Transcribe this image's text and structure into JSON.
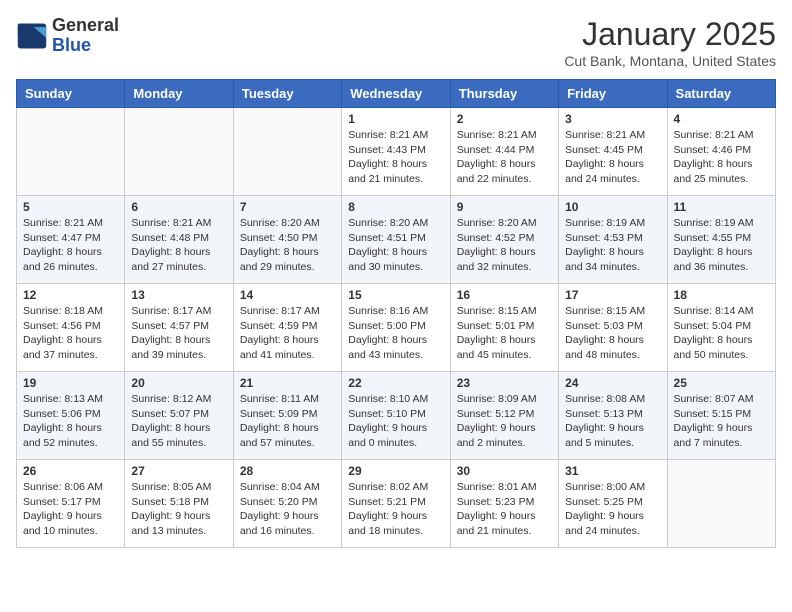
{
  "header": {
    "logo_general": "General",
    "logo_blue": "Blue",
    "month_title": "January 2025",
    "location": "Cut Bank, Montana, United States"
  },
  "days_of_week": [
    "Sunday",
    "Monday",
    "Tuesday",
    "Wednesday",
    "Thursday",
    "Friday",
    "Saturday"
  ],
  "weeks": [
    [
      {
        "day": "",
        "info": ""
      },
      {
        "day": "",
        "info": ""
      },
      {
        "day": "",
        "info": ""
      },
      {
        "day": "1",
        "info": "Sunrise: 8:21 AM\nSunset: 4:43 PM\nDaylight: 8 hours\nand 21 minutes."
      },
      {
        "day": "2",
        "info": "Sunrise: 8:21 AM\nSunset: 4:44 PM\nDaylight: 8 hours\nand 22 minutes."
      },
      {
        "day": "3",
        "info": "Sunrise: 8:21 AM\nSunset: 4:45 PM\nDaylight: 8 hours\nand 24 minutes."
      },
      {
        "day": "4",
        "info": "Sunrise: 8:21 AM\nSunset: 4:46 PM\nDaylight: 8 hours\nand 25 minutes."
      }
    ],
    [
      {
        "day": "5",
        "info": "Sunrise: 8:21 AM\nSunset: 4:47 PM\nDaylight: 8 hours\nand 26 minutes."
      },
      {
        "day": "6",
        "info": "Sunrise: 8:21 AM\nSunset: 4:48 PM\nDaylight: 8 hours\nand 27 minutes."
      },
      {
        "day": "7",
        "info": "Sunrise: 8:20 AM\nSunset: 4:50 PM\nDaylight: 8 hours\nand 29 minutes."
      },
      {
        "day": "8",
        "info": "Sunrise: 8:20 AM\nSunset: 4:51 PM\nDaylight: 8 hours\nand 30 minutes."
      },
      {
        "day": "9",
        "info": "Sunrise: 8:20 AM\nSunset: 4:52 PM\nDaylight: 8 hours\nand 32 minutes."
      },
      {
        "day": "10",
        "info": "Sunrise: 8:19 AM\nSunset: 4:53 PM\nDaylight: 8 hours\nand 34 minutes."
      },
      {
        "day": "11",
        "info": "Sunrise: 8:19 AM\nSunset: 4:55 PM\nDaylight: 8 hours\nand 36 minutes."
      }
    ],
    [
      {
        "day": "12",
        "info": "Sunrise: 8:18 AM\nSunset: 4:56 PM\nDaylight: 8 hours\nand 37 minutes."
      },
      {
        "day": "13",
        "info": "Sunrise: 8:17 AM\nSunset: 4:57 PM\nDaylight: 8 hours\nand 39 minutes."
      },
      {
        "day": "14",
        "info": "Sunrise: 8:17 AM\nSunset: 4:59 PM\nDaylight: 8 hours\nand 41 minutes."
      },
      {
        "day": "15",
        "info": "Sunrise: 8:16 AM\nSunset: 5:00 PM\nDaylight: 8 hours\nand 43 minutes."
      },
      {
        "day": "16",
        "info": "Sunrise: 8:15 AM\nSunset: 5:01 PM\nDaylight: 8 hours\nand 45 minutes."
      },
      {
        "day": "17",
        "info": "Sunrise: 8:15 AM\nSunset: 5:03 PM\nDaylight: 8 hours\nand 48 minutes."
      },
      {
        "day": "18",
        "info": "Sunrise: 8:14 AM\nSunset: 5:04 PM\nDaylight: 8 hours\nand 50 minutes."
      }
    ],
    [
      {
        "day": "19",
        "info": "Sunrise: 8:13 AM\nSunset: 5:06 PM\nDaylight: 8 hours\nand 52 minutes."
      },
      {
        "day": "20",
        "info": "Sunrise: 8:12 AM\nSunset: 5:07 PM\nDaylight: 8 hours\nand 55 minutes."
      },
      {
        "day": "21",
        "info": "Sunrise: 8:11 AM\nSunset: 5:09 PM\nDaylight: 8 hours\nand 57 minutes."
      },
      {
        "day": "22",
        "info": "Sunrise: 8:10 AM\nSunset: 5:10 PM\nDaylight: 9 hours\nand 0 minutes."
      },
      {
        "day": "23",
        "info": "Sunrise: 8:09 AM\nSunset: 5:12 PM\nDaylight: 9 hours\nand 2 minutes."
      },
      {
        "day": "24",
        "info": "Sunrise: 8:08 AM\nSunset: 5:13 PM\nDaylight: 9 hours\nand 5 minutes."
      },
      {
        "day": "25",
        "info": "Sunrise: 8:07 AM\nSunset: 5:15 PM\nDaylight: 9 hours\nand 7 minutes."
      }
    ],
    [
      {
        "day": "26",
        "info": "Sunrise: 8:06 AM\nSunset: 5:17 PM\nDaylight: 9 hours\nand 10 minutes."
      },
      {
        "day": "27",
        "info": "Sunrise: 8:05 AM\nSunset: 5:18 PM\nDaylight: 9 hours\nand 13 minutes."
      },
      {
        "day": "28",
        "info": "Sunrise: 8:04 AM\nSunset: 5:20 PM\nDaylight: 9 hours\nand 16 minutes."
      },
      {
        "day": "29",
        "info": "Sunrise: 8:02 AM\nSunset: 5:21 PM\nDaylight: 9 hours\nand 18 minutes."
      },
      {
        "day": "30",
        "info": "Sunrise: 8:01 AM\nSunset: 5:23 PM\nDaylight: 9 hours\nand 21 minutes."
      },
      {
        "day": "31",
        "info": "Sunrise: 8:00 AM\nSunset: 5:25 PM\nDaylight: 9 hours\nand 24 minutes."
      },
      {
        "day": "",
        "info": ""
      }
    ]
  ]
}
